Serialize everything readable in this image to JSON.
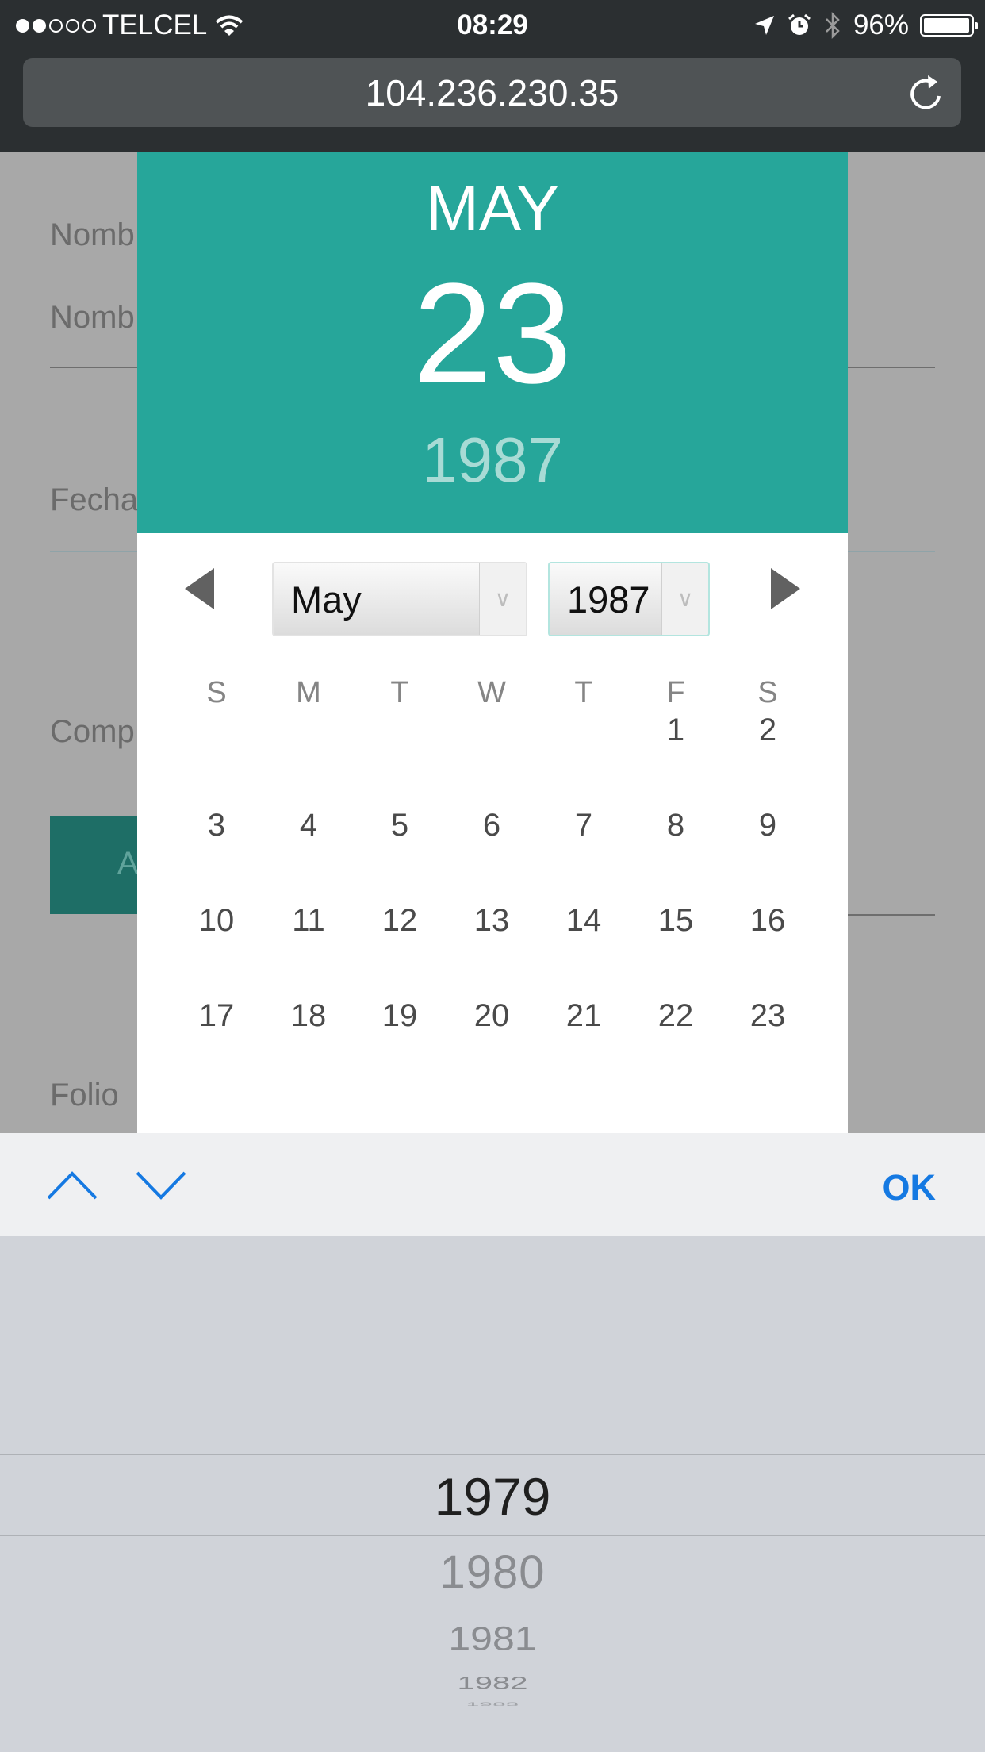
{
  "status_bar": {
    "carrier": "TELCEL",
    "time": "08:29",
    "battery": "96%"
  },
  "browser": {
    "url": "104.236.230.35"
  },
  "form_labels": [
    "Nomb",
    "Nomb",
    "Fecha",
    "Comp",
    "A",
    "Folio"
  ],
  "picker": {
    "header_month": "MAY",
    "header_day": "23",
    "header_year": "1987",
    "month_select": "May",
    "year_select": "1987",
    "weekdays": [
      "S",
      "M",
      "T",
      "W",
      "T",
      "F",
      "S"
    ],
    "weeks": [
      [
        "",
        "",
        "",
        "",
        "",
        "1",
        "2"
      ],
      [
        "3",
        "4",
        "5",
        "6",
        "7",
        "8",
        "9"
      ],
      [
        "10",
        "11",
        "12",
        "13",
        "14",
        "15",
        "16"
      ],
      [
        "17",
        "18",
        "19",
        "20",
        "21",
        "22",
        "23"
      ]
    ]
  },
  "keyboard": {
    "done_label": "OK",
    "wheel_selected": "1979",
    "wheel_below": [
      "1980",
      "1981",
      "1982",
      "1983"
    ]
  },
  "colors": {
    "accent": "#26a69a",
    "ios_blue": "#1579e2"
  },
  "icons": [
    "wifi-icon",
    "location-arrow-icon",
    "alarm-icon",
    "bluetooth-icon",
    "battery-icon",
    "reload-icon",
    "chevron-up-icon",
    "chevron-down-icon",
    "prev-month-icon",
    "next-month-icon"
  ]
}
